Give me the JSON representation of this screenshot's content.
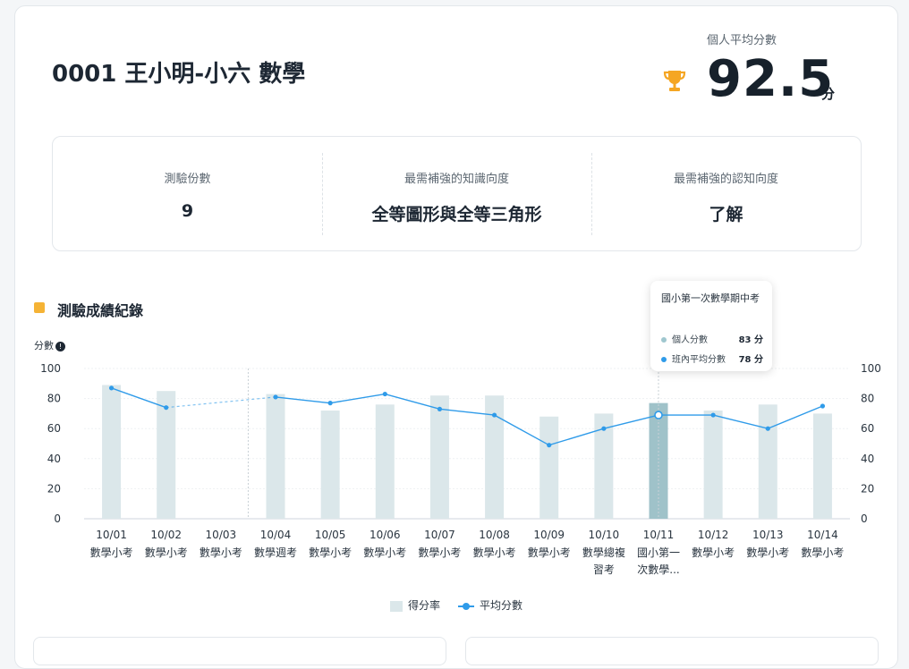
{
  "header": {
    "title": "0001 王小明-小六 數學",
    "avg_label": "個人平均分數",
    "avg_value": "92.5",
    "avg_unit": "分"
  },
  "stats": [
    {
      "label": "測驗份數",
      "value": "9"
    },
    {
      "label": "最需補強的知識向度",
      "value": "全等圖形與全等三角形"
    },
    {
      "label": "最需補強的認知向度",
      "value": "了解"
    }
  ],
  "section": {
    "title": "測驗成績紀錄",
    "axis_title": "分數",
    "info_icon": "!"
  },
  "tooltip": {
    "title": "國小第一次數學期中考",
    "rows": [
      {
        "label": "個人分數",
        "value": "83 分",
        "color": "#9fc7cf"
      },
      {
        "label": "班內平均分數",
        "value": "78 分",
        "color": "#2f9be9"
      }
    ]
  },
  "chart_data": {
    "type": "bar",
    "categories": [
      "10/01",
      "10/02",
      "10/03",
      "10/04",
      "10/05",
      "10/06",
      "10/07",
      "10/08",
      "10/09",
      "10/10",
      "10/11",
      "10/12",
      "10/13",
      "10/14"
    ],
    "category_sublabels": [
      [
        "數學小考"
      ],
      [
        "數學小考"
      ],
      [
        "數學小考"
      ],
      [
        "數學週考"
      ],
      [
        "數學小考"
      ],
      [
        "數學小考"
      ],
      [
        "數學小考"
      ],
      [
        "數學小考"
      ],
      [
        "數學小考"
      ],
      [
        "數學總複",
        "習考"
      ],
      [
        "國小第一",
        "次數學..."
      ],
      [
        "數學小考"
      ],
      [
        "數學小考"
      ],
      [
        "數學小考"
      ]
    ],
    "series": [
      {
        "name": "得分率",
        "type": "bar",
        "axis": "left",
        "color": "#dbe7ea",
        "values": [
          89,
          85,
          null,
          83,
          72,
          76,
          82,
          82,
          68,
          70,
          77,
          72,
          76,
          70
        ]
      },
      {
        "name": "平均分數",
        "type": "line",
        "axis": "right",
        "color": "#2f9be9",
        "values": [
          87,
          74,
          null,
          81,
          77,
          83,
          73,
          69,
          49,
          60,
          69,
          69,
          60,
          75
        ]
      }
    ],
    "highlight_index": 10,
    "highlight_color": "#9fc2c9",
    "ylim_left": [
      0,
      100
    ],
    "ylim_right": [
      0,
      100
    ],
    "yticks_left": [
      0,
      20,
      40,
      60,
      80,
      100
    ],
    "yticks_right": [
      0,
      20,
      40,
      60,
      80,
      100
    ],
    "grid": true,
    "legend_position": "bottom-center"
  }
}
